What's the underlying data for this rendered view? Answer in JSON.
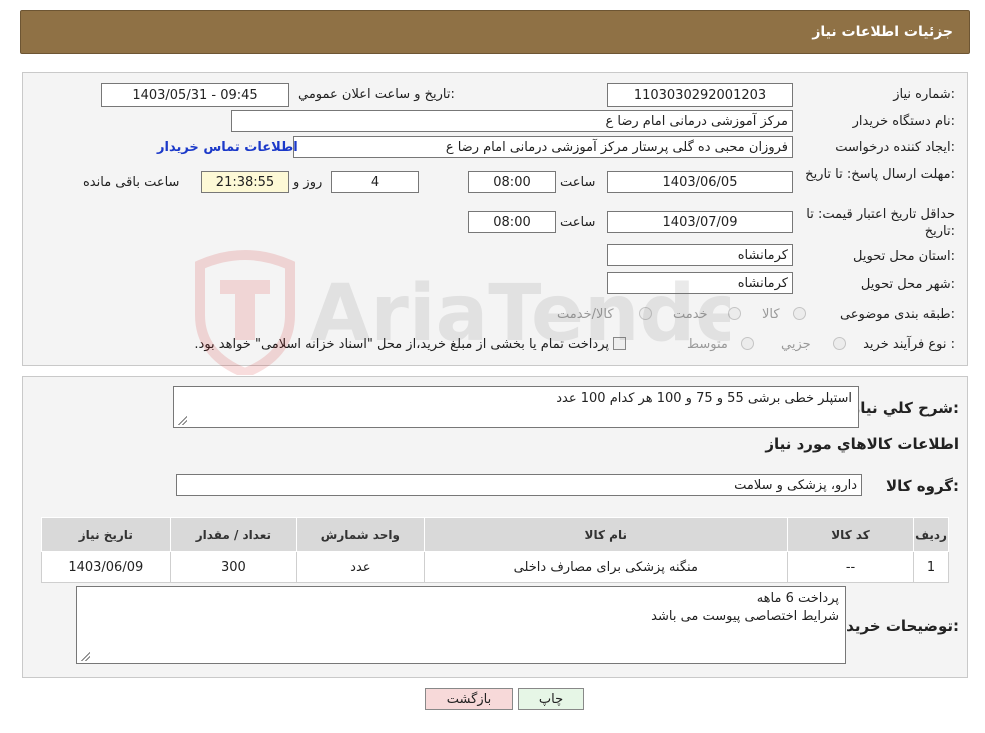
{
  "header": {
    "title": "جزئیات اطلاعات نیاز"
  },
  "form": {
    "need_number_label": "شماره نیاز:",
    "need_number": "1103030292001203",
    "announce_label": "تاریخ و ساعت اعلان عمومي:",
    "announce_value": "1403/05/31 - 09:45",
    "buyer_org_label": "نام دستگاه خریدار:",
    "buyer_org": "مرکز آموزشی  درمانی امام رضا  ع",
    "creator_label": "ایجاد کننده درخواست:",
    "creator": "فروزان محبی ده گلی پرستار مرکز آموزشی  درمانی امام رضا  ع",
    "contact_link": "اطلاعات تماس خریدار",
    "reply_deadline_label": "مهلت ارسال پاسخ: تا تاریخ:",
    "reply_date": "1403/06/05",
    "time_label": "ساعت",
    "reply_time": "08:00",
    "days_value": "4",
    "days_label": "روز و",
    "remaining_time": "21:38:55",
    "remaining_label": "ساعت باقی مانده",
    "validity_label": "حداقل تاریخ اعتبار قیمت: تا تاریخ:",
    "validity_date": "1403/07/09",
    "validity_time": "08:00",
    "province_label": "استان محل تحویل:",
    "province": "کرمانشاه",
    "city_label": "شهر محل تحویل:",
    "city": "کرمانشاه",
    "category_label": "طبقه بندی موضوعی:",
    "category_options": [
      "کالا",
      "خدمت",
      "کالا/خدمت"
    ],
    "process_label": "نوع فرآیند خرید :",
    "process_options": [
      "جزیي",
      "متوسط"
    ],
    "payment_note": "پرداخت تمام یا بخشی از مبلغ خرید،از محل \"اسناد خزانه اسلامی\" خواهد بود."
  },
  "details": {
    "summary_label": "شرح کلي نياز:",
    "summary": "استپلر خطی برشی    55 و 75 و 100     هر کدام 100  عدد",
    "goods_info_title": "اطلاعات کالاهاي مورد نياز",
    "goods_group_label": "گروه کالا:",
    "goods_group": "دارو، پزشکی و سلامت",
    "table": {
      "headers": [
        "رديف",
        "کد کالا",
        "نام کالا",
        "واحد شمارش",
        "تعداد / مقدار",
        "تاريخ نياز"
      ],
      "rows": [
        [
          "1",
          "--",
          "منگنه پزشکی برای مصارف داخلی",
          "عدد",
          "300",
          "1403/06/09"
        ]
      ]
    },
    "buyer_notes_label": "توضیحات خریدار:",
    "buyer_notes_line1": "پرداخت 6 ماهه",
    "buyer_notes_line2": "شرایط اختصاصی پیوست می باشد"
  },
  "buttons": {
    "print": "چاپ",
    "back": "بازگشت"
  },
  "watermark": {
    "text": "AriaTender.neT"
  },
  "colors": {
    "header_bg": "#8f7145",
    "link": "#1b39c9",
    "back_button_bg": "#f7d9d9",
    "print_button_bg": "#e6f6e6",
    "remaining_bg": "#fdf9d6"
  }
}
